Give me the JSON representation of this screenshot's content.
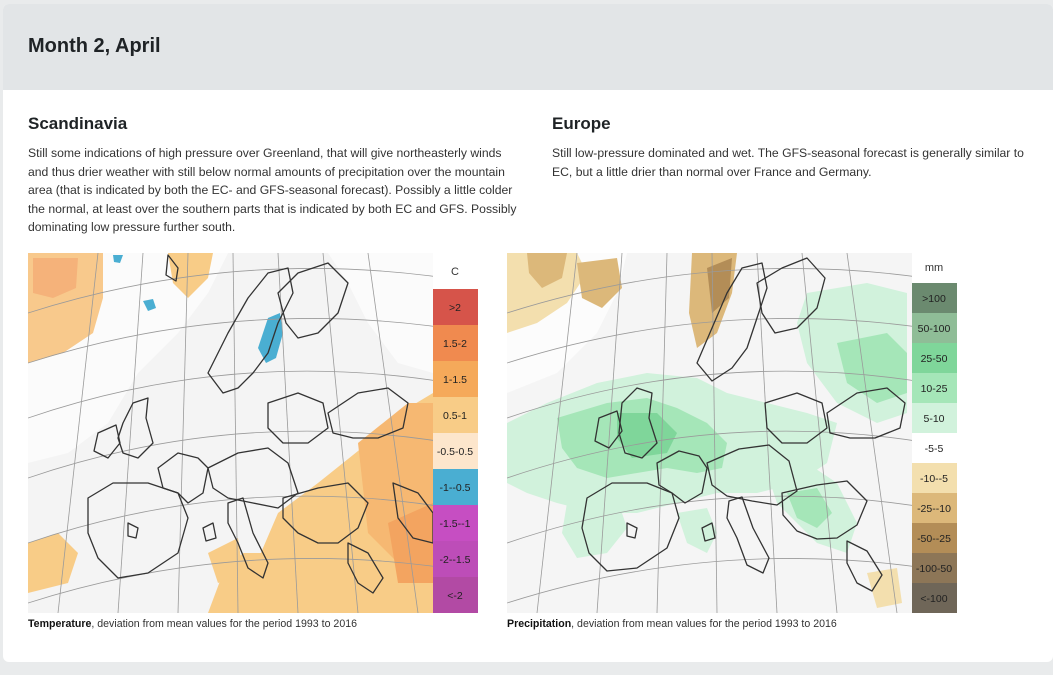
{
  "header": {
    "title": "Month 2, April"
  },
  "scandinavia": {
    "title": "Scandinavia",
    "text": "Still some indications of high pressure over Greenland, that will give northeasterly winds and thus drier weather with still below normal amounts of precipitation over the mountain area (that is indicated by both the EC- and GFS-seasonal forecast). Possibly a little colder the normal, at least over the southern parts that is indicated by both EC and GFS. Possibly dominating low pressure further south."
  },
  "europe": {
    "title": "Europe",
    "text": "Still low-pressure dominated and wet. The GFS-seasonal forecast is generally similar to EC, but a little drier than normal over France and Germany."
  },
  "temperature_map": {
    "legend_unit": "C",
    "legend": [
      {
        "label": ">2",
        "color": "#d6544a"
      },
      {
        "label": "1.5-2",
        "color": "#f08a4f"
      },
      {
        "label": "1-1.5",
        "color": "#f5a95a"
      },
      {
        "label": "0.5-1",
        "color": "#f8cc87"
      },
      {
        "label": "-0.5-0.5",
        "color": "#fde6cc"
      },
      {
        "label": "-1--0.5",
        "color": "#4aaed2"
      },
      {
        "label": "-1.5--1",
        "color": "#c64ec2"
      },
      {
        "label": "-2--1.5",
        "color": "#bd4db8"
      },
      {
        "label": "<-2",
        "color": "#b24aa4"
      }
    ],
    "caption_bold": "Temperature",
    "caption_rest": ", deviation from mean values for the period 1993 to 2016"
  },
  "precipitation_map": {
    "legend_unit": "mm",
    "legend": [
      {
        "label": ">100",
        "color": "#6b8a6f"
      },
      {
        "label": "50-100",
        "color": "#8fbd97"
      },
      {
        "label": "25-50",
        "color": "#7fd69a"
      },
      {
        "label": "10-25",
        "color": "#a5e6b8"
      },
      {
        "label": "5-10",
        "color": "#d1f2dc"
      },
      {
        "label": "-5-5",
        "color": "#ffffff"
      },
      {
        "label": "-10--5",
        "color": "#f3dfae"
      },
      {
        "label": "-25--10",
        "color": "#dcb87a"
      },
      {
        "label": "-50--25",
        "color": "#b38d57"
      },
      {
        "label": "-100-50",
        "color": "#8d7657"
      },
      {
        "label": "<-100",
        "color": "#6f6658"
      }
    ],
    "caption_bold": "Precipitation",
    "caption_rest": ", deviation from mean values for the period 1993 to 2016"
  }
}
